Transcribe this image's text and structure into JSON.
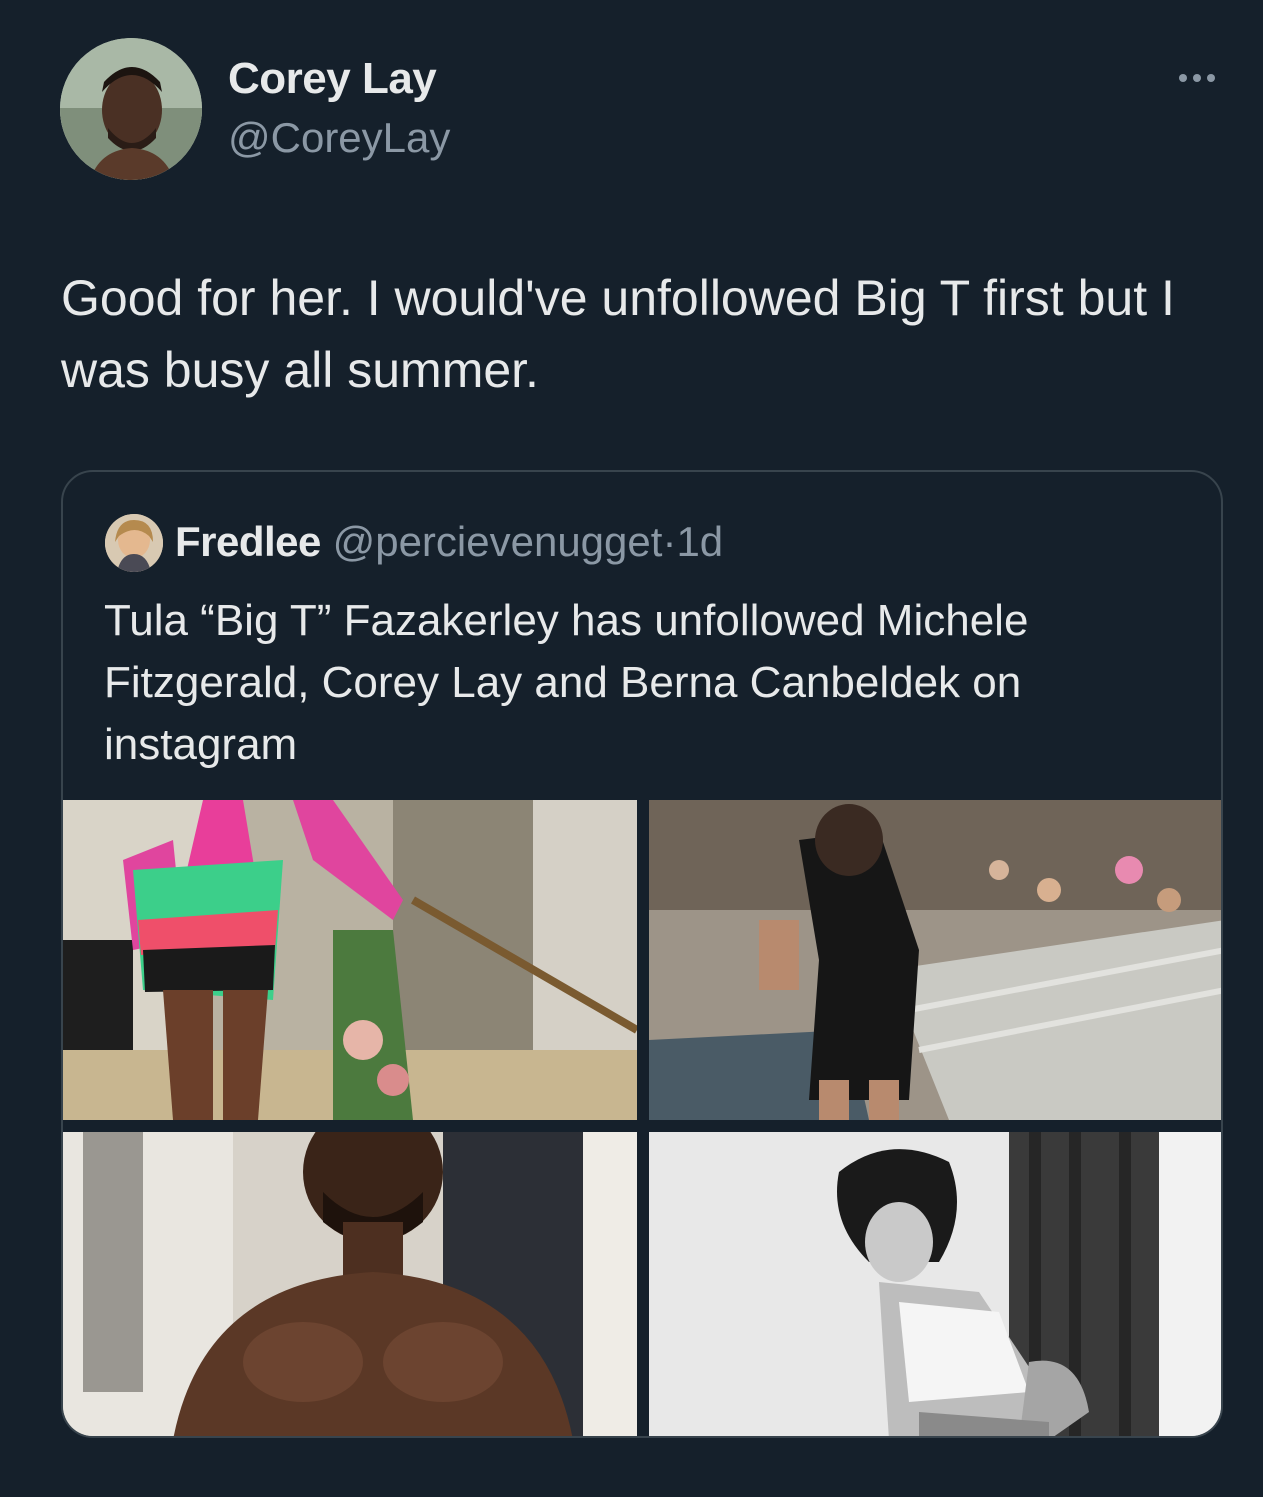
{
  "tweet": {
    "author": {
      "display_name": "Corey Lay",
      "handle": "@CoreyLay",
      "avatar_icon": "profile-photo"
    },
    "more_icon": "more-options-icon",
    "text": "Good for her. I would've unfollowed Big T first but I was busy all summer."
  },
  "quoted_tweet": {
    "author": {
      "display_name": "Fredlee",
      "handle": "@percievenugget",
      "avatar_icon": "profile-photo"
    },
    "separator": "·",
    "time": "1d",
    "text": "Tula “Big T” Fazakerley has unfollowed Michele Fitzgerald, Corey Lay and Berna Canbeldek on instagram",
    "media_count": 4
  },
  "colors": {
    "background": "#15202b",
    "text_primary": "#e7e9ea",
    "text_secondary": "#8b98a5",
    "border": "#38444d"
  }
}
